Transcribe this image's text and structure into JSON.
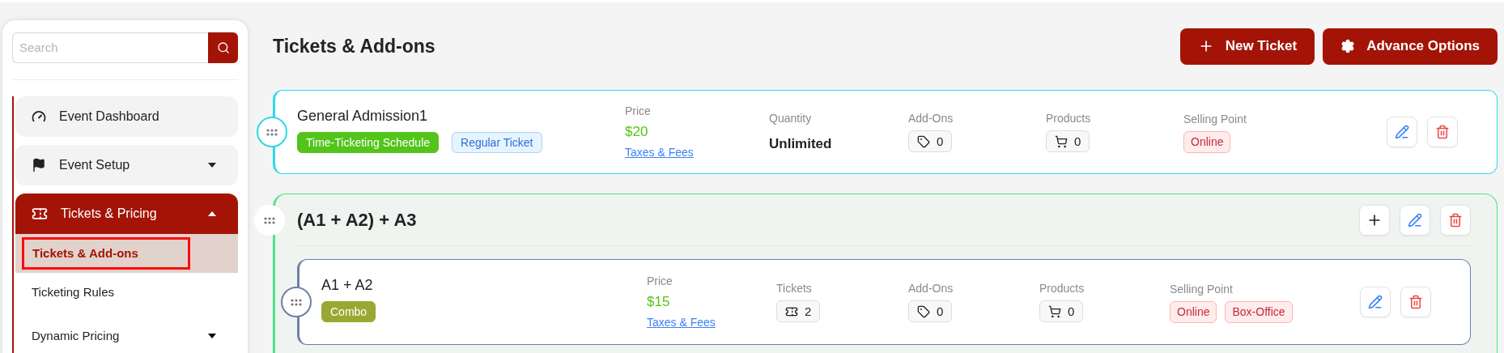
{
  "sidebar": {
    "search": {
      "placeholder": "Search"
    },
    "items": [
      {
        "label": "Event Dashboard",
        "kind": "link",
        "selected": false
      },
      {
        "label": "Event Setup",
        "kind": "menu",
        "selected": false,
        "expanded": false
      },
      {
        "label": "Tickets & Pricing",
        "kind": "menu",
        "selected": true,
        "expanded": true,
        "children": [
          {
            "label": "Tickets & Add-ons",
            "kind": "link",
            "selected": true
          },
          {
            "label": "Ticketing Rules",
            "kind": "link",
            "selected": false
          },
          {
            "label": "Dynamic Pricing",
            "kind": "menu",
            "selected": false,
            "expanded": false
          }
        ]
      }
    ]
  },
  "header": {
    "title": "Tickets & Add-ons",
    "buttons": [
      {
        "label": "New Ticket"
      },
      {
        "label": "Advance Options"
      }
    ]
  },
  "cards": [
    {
      "kind": "ticket",
      "name": "General Admission1",
      "tags": [
        {
          "label": "Time-Ticketing Schedule",
          "kind": "schedule"
        },
        {
          "label": "Regular Ticket",
          "kind": "type"
        }
      ],
      "fields": [
        {
          "label": "Price",
          "kind": "price",
          "value": "$20",
          "link": "Taxes & Fees"
        },
        {
          "label": "Quantity",
          "kind": "text",
          "value": "Unlimited"
        },
        {
          "label": "Add-Ons",
          "kind": "tag-count",
          "value": "0"
        },
        {
          "label": "Products",
          "kind": "cart-count",
          "value": "0"
        },
        {
          "label": "Selling Point",
          "kind": "badges",
          "badges": [
            "Online"
          ]
        }
      ]
    },
    {
      "kind": "group",
      "name": "(A1 + A2) + A3",
      "children": [
        {
          "kind": "ticket",
          "name": "A1 + A2",
          "tags": [
            {
              "label": "Combo",
              "kind": "combo"
            }
          ],
          "fields": [
            {
              "label": "Price",
              "kind": "price",
              "value": "$15",
              "link": "Taxes & Fees"
            },
            {
              "label": "Tickets",
              "kind": "ticket-count",
              "value": "2"
            },
            {
              "label": "Add-Ons",
              "kind": "tag-count",
              "value": "0"
            },
            {
              "label": "Products",
              "kind": "cart-count",
              "value": "0"
            },
            {
              "label": "Selling Point",
              "kind": "badges",
              "badges": [
                "Online",
                "Box-Office"
              ]
            }
          ]
        }
      ]
    }
  ]
}
